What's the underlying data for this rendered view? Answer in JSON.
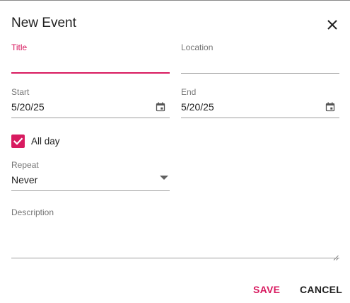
{
  "dialog": {
    "title": "New Event",
    "close_icon": "close-icon"
  },
  "form": {
    "title": {
      "label": "Title",
      "value": ""
    },
    "location": {
      "label": "Location",
      "value": ""
    },
    "start": {
      "label": "Start",
      "value": "5/20/25",
      "icon": "calendar-icon"
    },
    "end": {
      "label": "End",
      "value": "5/20/25",
      "icon": "calendar-icon"
    },
    "all_day": {
      "label": "All day",
      "checked": true
    },
    "repeat": {
      "label": "Repeat",
      "value": "Never"
    },
    "description": {
      "label": "Description",
      "value": ""
    }
  },
  "actions": {
    "save_label": "SAVE",
    "cancel_label": "CANCEL"
  },
  "colors": {
    "accent": "#d81b60",
    "text": "#212121",
    "label": "#757575",
    "underline": "#9e9e9e"
  }
}
